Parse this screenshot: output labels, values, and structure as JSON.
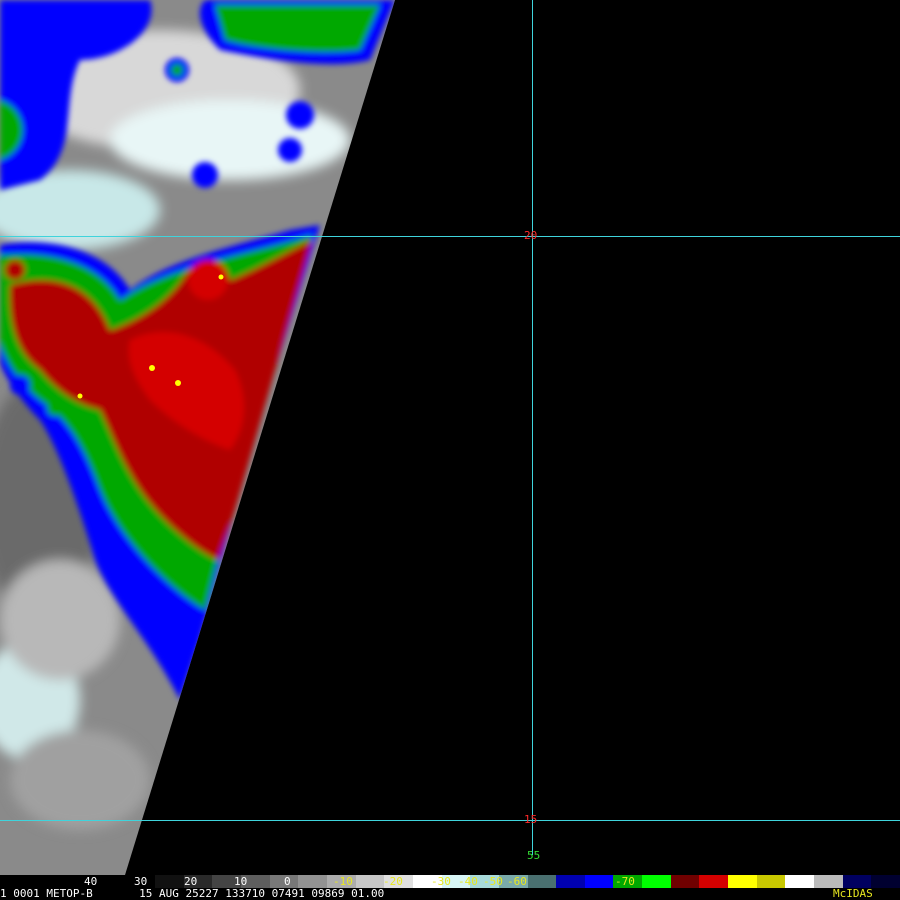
{
  "colors": {
    "gridline": "#3fd4dc",
    "lat_label": "#ff2a2a",
    "lon_label": "#33dd33",
    "colorbar_label_neutral": "#ffffff",
    "colorbar_label_warm": "#e8e820",
    "status_text": "#ffffff",
    "brand_text": "#e8e820"
  },
  "grid": {
    "lat_20": "20",
    "lat_15": "15",
    "lon_55": "55"
  },
  "colorbar": {
    "labels": [
      "40",
      "30",
      "20",
      "10",
      "0",
      "-10",
      "-20",
      "-30",
      "-40",
      "-50",
      "-60",
      "-70"
    ],
    "segments": [
      "#111111",
      "#2a2a2a",
      "#444444",
      "#5e5e5e",
      "#787878",
      "#929292",
      "#acacac",
      "#c6c6c6",
      "#e0e0e0",
      "#ffffff",
      "#d8f6f6",
      "#a8dada",
      "#7aaaaa",
      "#4a7070",
      "#0000b0",
      "#0000ff",
      "#00a800",
      "#00ff00",
      "#700000",
      "#d40000",
      "#ffff00",
      "#c8c800",
      "#ffffff",
      "#bbbbbb",
      "#000060",
      "#000030"
    ]
  },
  "status": {
    "frame": "1",
    "image_id": "0001",
    "satellite": "METOP-B",
    "date": "15 AUG 25227",
    "time": "133710",
    "line": "07491",
    "element": "09869",
    "resolution": "01.00",
    "brand": "McIDAS"
  }
}
